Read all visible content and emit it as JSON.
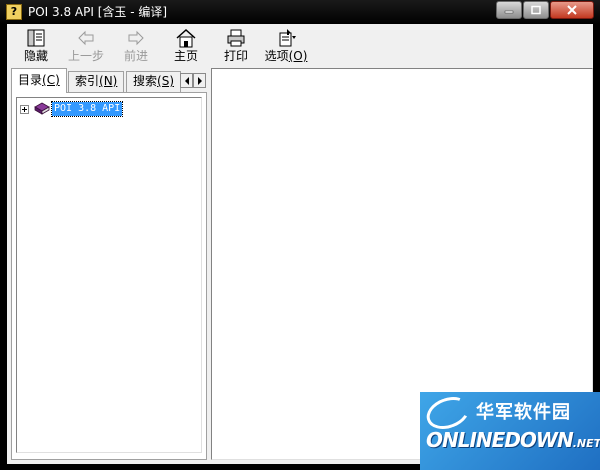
{
  "window": {
    "title": "POI 3.8 API [含玉 - 编译]"
  },
  "toolbar": {
    "buttons": [
      {
        "label": "隐藏",
        "icon": "hide-pane-icon",
        "enabled": true
      },
      {
        "label": "上一步",
        "icon": "back-arrow-icon",
        "enabled": false
      },
      {
        "label": "前进",
        "icon": "forward-arrow-icon",
        "enabled": false
      },
      {
        "label": "主页",
        "icon": "home-icon",
        "enabled": true
      },
      {
        "label": "打印",
        "icon": "printer-icon",
        "enabled": true
      },
      {
        "label": "选项",
        "label_key": "(O)",
        "icon": "options-icon",
        "enabled": true
      }
    ]
  },
  "nav_tabs": [
    {
      "label": "目录",
      "key": "(C)",
      "active": true
    },
    {
      "label": "索引",
      "key": "(N)",
      "active": false
    },
    {
      "label": "搜索",
      "key": "(S)",
      "active": false
    }
  ],
  "tree": {
    "items": [
      {
        "label": "POI 3.8 API",
        "expanded": false,
        "selected": true,
        "icon": "book-icon"
      }
    ]
  },
  "watermark": {
    "top_text": "华军软件园",
    "bottom_text": "ONLINEDOWN",
    "bottom_suffix": ".NET"
  },
  "colors": {
    "selection": "#3399ff",
    "watermark_blue": "#1f6fc2"
  }
}
